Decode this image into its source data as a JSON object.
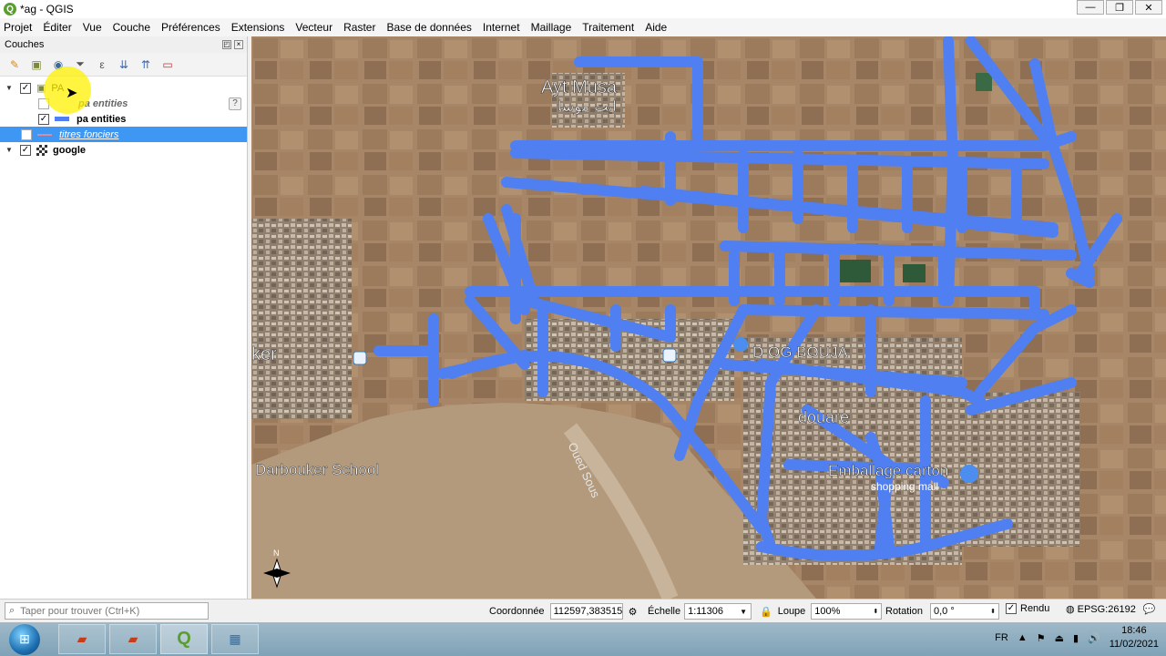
{
  "window": {
    "title": "*ag - QGIS",
    "minimize": "—",
    "maximize": "❐",
    "close": "✕"
  },
  "menu": [
    "Projet",
    "Éditer",
    "Vue",
    "Couche",
    "Préférences",
    "Extensions",
    "Vecteur",
    "Raster",
    "Base de données",
    "Internet",
    "Maillage",
    "Traitement",
    "Aide"
  ],
  "layers_panel": {
    "title": "Couches",
    "layers": [
      {
        "name": "PA",
        "level": 0,
        "checked": true,
        "expanded": true
      },
      {
        "name": "pa entities",
        "level": 1,
        "checked": false,
        "style": "italic"
      },
      {
        "name": "pa entities",
        "level": 1,
        "checked": true
      },
      {
        "name": "titres fonciers",
        "level": 0,
        "checked": false,
        "selected": true
      },
      {
        "name": "google",
        "level": 0,
        "checked": true,
        "expanded": true
      }
    ],
    "help": "?"
  },
  "map_labels": {
    "ayt_musa": "Ayt Musa",
    "ayt_musa_ar": "ايت موسا",
    "douar_bouja": "D OG BOUJA",
    "ker": "ker",
    "darbouker": "Darbouker School",
    "oued_sous": "Oued Sous",
    "douar_e": "douare",
    "embal": "Emballage carton",
    "shopping": "shopping mall",
    "north": "N"
  },
  "statusbar": {
    "search_placeholder": "Taper pour trouver (Ctrl+K)",
    "coord_label": "Coordonnée",
    "coord_value": "112597,383515",
    "scale_label": "Échelle",
    "scale_value": "1:11306",
    "loupe_label": "Loupe",
    "loupe_value": "100%",
    "rotation_label": "Rotation",
    "rotation_value": "0,0 °",
    "render_label": "Rendu",
    "epsg": "EPSG:26192"
  },
  "taskbar": {
    "lang": "FR",
    "time": "18:46",
    "date": "11/02/2021"
  },
  "colors": {
    "road": "#4f7ff0",
    "selection": "#3d97f3"
  }
}
